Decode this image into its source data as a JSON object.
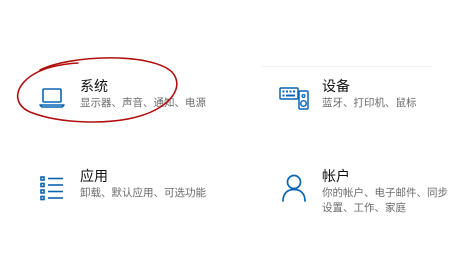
{
  "tiles": {
    "system": {
      "title": "系统",
      "desc": "显示器、声音、通知、电源",
      "icon": "laptop-icon"
    },
    "devices": {
      "title": "设备",
      "desc": "蓝牙、打印机、鼠标",
      "icon": "keyboard-speaker-icon"
    },
    "apps": {
      "title": "应用",
      "desc": "卸载、默认应用、可选功能",
      "icon": "list-icon"
    },
    "accounts": {
      "title": "帐户",
      "desc": [
        "你的帐户、电子邮件、同步",
        "设置、工作、家庭"
      ],
      "icon": "person-icon"
    }
  },
  "colors": {
    "accent": "#0a64b4",
    "title": "#111111",
    "desc": "#6b6b6b",
    "annotation": "#b01010"
  }
}
